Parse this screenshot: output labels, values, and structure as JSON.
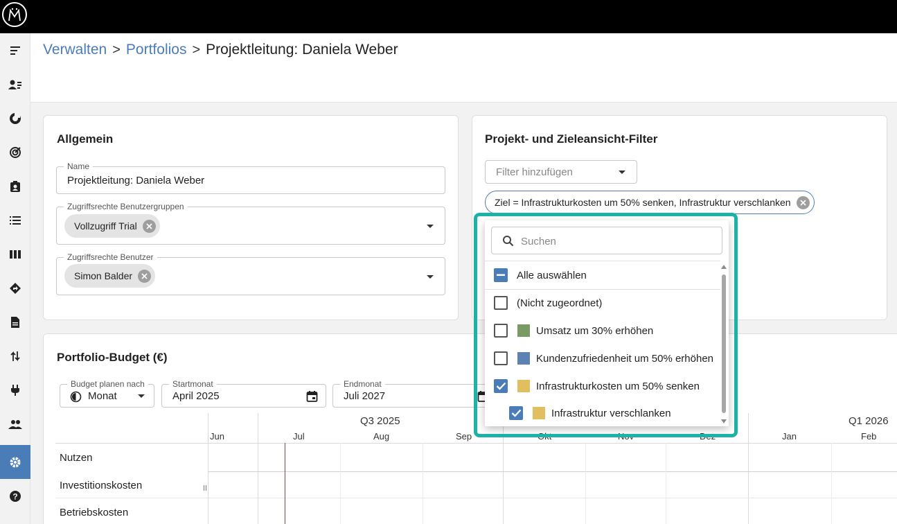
{
  "breadcrumb": {
    "item1": "Verwalten",
    "item2": "Portfolios",
    "current": "Projektleitung: Daniela Weber",
    "separator": ">"
  },
  "allgemein": {
    "title": "Allgemein",
    "name_label": "Name",
    "name_value": "Projektleitung: Daniela Weber",
    "groups_label": "Zugriffsrechte Benutzergruppen",
    "groups_chip": "Vollzugriff Trial",
    "users_label": "Zugriffsrechte Benutzer",
    "users_chip": "Simon Balder"
  },
  "filter_card": {
    "title": "Projekt- und Zieleansicht-Filter",
    "add_filter_placeholder": "Filter hinzufügen",
    "active_filter": "Ziel = Infrastrukturkosten um 50% senken, Infrastruktur verschlanken"
  },
  "dropdown": {
    "search_placeholder": "Suchen",
    "select_all": "Alle auswählen",
    "items": [
      {
        "label": "(Nicht zugeordnet)",
        "checked": false,
        "color": ""
      },
      {
        "label": "Umsatz um 30% erhöhen",
        "checked": false,
        "color": "#7a9a64"
      },
      {
        "label": "Kundenzufriedenheit um 50% erhöhen",
        "checked": false,
        "color": "#5b82b3"
      },
      {
        "label": "Infrastrukturkosten um 50% senken",
        "checked": true,
        "color": "#e1bf5e"
      },
      {
        "label": "Infrastruktur verschlanken",
        "checked": true,
        "color": "#e1bf5e"
      }
    ]
  },
  "budget": {
    "title": "Portfolio-Budget (€)",
    "plan_label": "Budget planen nach",
    "plan_value": "Monat",
    "start_label": "Startmonat",
    "start_value": "April 2025",
    "end_label": "Endmonat",
    "end_value": "Juli 2027",
    "quarters": [
      "Q3 2025",
      "Q1 2026"
    ],
    "months": [
      "Jun",
      "Jul",
      "Aug",
      "Sep",
      "Okt",
      "Nov",
      "Dez",
      "Jan",
      "Feb"
    ],
    "rows": [
      "Nutzen",
      "Investitionskosten",
      "Betriebskosten"
    ]
  },
  "colors": {
    "accent": "#4a7db8",
    "highlight": "#1bb3a6"
  }
}
